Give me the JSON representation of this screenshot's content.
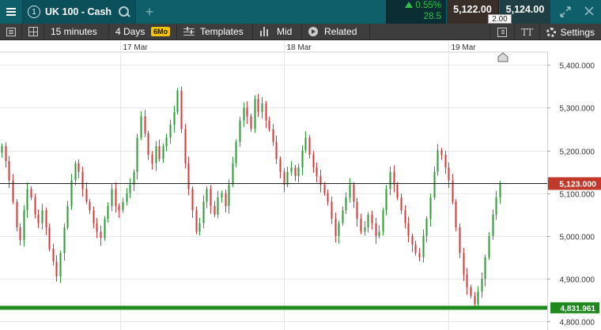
{
  "topbar": {
    "tab_number": "1",
    "instrument": "UK 100 - Cash",
    "change_pct": "0.55%",
    "change_points": "28.5",
    "sell_price": "5,122.00",
    "spread": "2.00",
    "buy_price": "5,124.00",
    "add_tab": "+"
  },
  "toolbar": {
    "interval": "15 minutes",
    "range": "4 Days",
    "badge": "6Mo",
    "templates": "Templates",
    "price_mode": "Mid",
    "related": "Related",
    "settings": "Settings",
    "text_size": "TT"
  },
  "chart_data": {
    "type": "candlestick",
    "x_ticks": [
      "17 Mar",
      "18 Mar",
      "19 Mar"
    ],
    "y_ticks": [
      4800,
      4900,
      5000,
      5100,
      5200,
      5300,
      5400
    ],
    "y_tick_labels": [
      "4,800.000",
      "4,900.000",
      "5,000.000",
      "5,100.000",
      "5,200.000",
      "5,300.000",
      "5,400.000"
    ],
    "ylim": [
      4780,
      5430
    ],
    "current_price": 5123.0,
    "current_price_label": "5,123.000",
    "horizontal_line": 4831.961,
    "horizontal_line_label": "4,831.961",
    "grid": true,
    "colors": {
      "up": "#2e9a3a",
      "down": "#d23a3a",
      "current_line": "#222222",
      "current_badge": "#c0392b",
      "level_line": "#1e8a1e"
    },
    "closes": [
      5210,
      5175,
      5130,
      5080,
      5020,
      4990,
      5060,
      5110,
      5090,
      5050,
      5030,
      5060,
      5020,
      4970,
      4940,
      4905,
      4960,
      5020,
      5070,
      5130,
      5170,
      5150,
      5110,
      5080,
      5060,
      5030,
      5010,
      4995,
      5040,
      5070,
      5110,
      5070,
      5060,
      5080,
      5100,
      5120,
      5150,
      5230,
      5280,
      5240,
      5190,
      5170,
      5210,
      5180,
      5210,
      5230,
      5260,
      5290,
      5340,
      5250,
      5170,
      5110,
      5060,
      5010,
      5030,
      5080,
      5110,
      5070,
      5050,
      5090,
      5100,
      5070,
      5120,
      5170,
      5220,
      5270,
      5300,
      5280,
      5250,
      5320,
      5290,
      5310,
      5270,
      5250,
      5220,
      5180,
      5150,
      5120,
      5150,
      5160,
      5140,
      5160,
      5200,
      5230,
      5190,
      5160,
      5140,
      5120,
      5100,
      5080,
      5040,
      5000,
      5030,
      5060,
      5090,
      5120,
      5080,
      5040,
      5010,
      5020,
      5050,
      5030,
      5000,
      5010,
      5060,
      5110,
      5150,
      5120,
      5090,
      5060,
      5030,
      5000,
      4980,
      4960,
      4950,
      5000,
      5040,
      5090,
      5150,
      5200,
      5190,
      5160,
      5130,
      5080,
      5020,
      4960,
      4910,
      4880,
      4860,
      4840,
      4870,
      4900,
      4950,
      5000,
      5050,
      5090,
      5123
    ]
  }
}
